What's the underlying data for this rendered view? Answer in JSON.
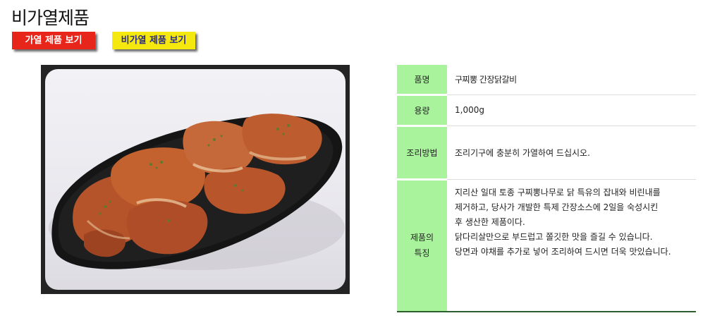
{
  "page": {
    "title": "비가열제품"
  },
  "buttons": {
    "heated_label": "가열 제품 보기",
    "nonheated_label": "비가열 제품 보기"
  },
  "product_image": {
    "subject": "marinated soy sauce chicken galbi on black plate"
  },
  "spec": {
    "name_label": "품명",
    "name_value": "구찌뽕 간장닭갈비",
    "volume_label": "용량",
    "volume_value": "1,000g",
    "cooking_label": "조리방법",
    "cooking_value": "조리기구에 충분히 가열하여 드십시오.",
    "features_label_line1": "제품의",
    "features_label_line2": "특징",
    "features_lines": [
      "지리산 일대 토종 구찌뽕나무로 닭 특유의 잡내와 비린내를",
      "제거하고, 당사가 개발한 특제 간장소스에 2일을 숙성시킨",
      "후 생산한 제품이다.",
      "닭다리살만으로 부드럽고 쫄깃한 맛을 즐길 수 있습니다.",
      "당면과 야채를 추가로 넣어 조리하여 드시면 더욱 맛있습니다."
    ]
  },
  "colors": {
    "heated_button": "#e8251a",
    "nonheated_button": "#f4e80f",
    "label_cell": "#aaf39d"
  }
}
